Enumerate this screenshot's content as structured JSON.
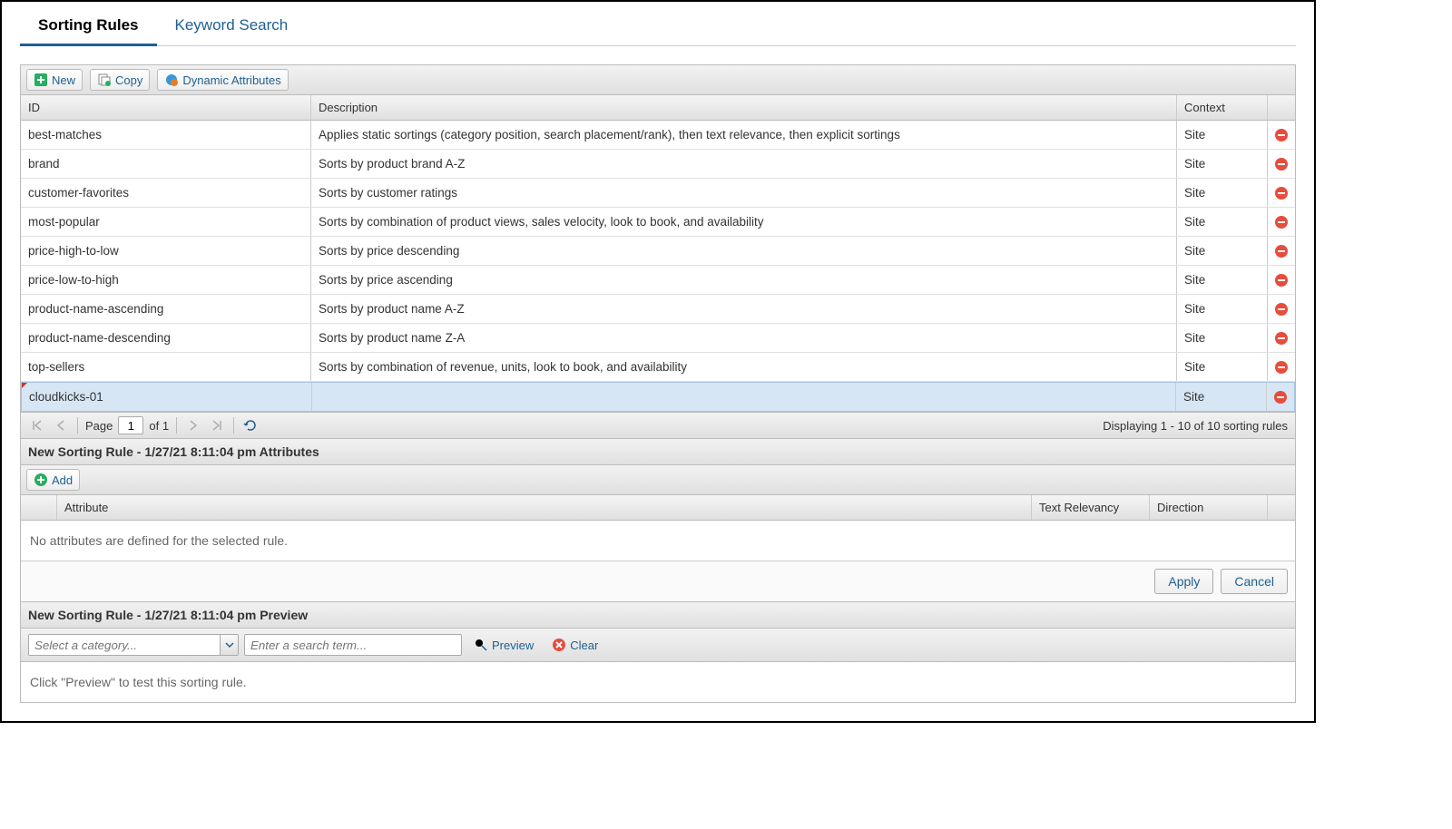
{
  "tabs": [
    {
      "label": "Sorting Rules",
      "active": true
    },
    {
      "label": "Keyword Search",
      "active": false
    }
  ],
  "toolbar": {
    "new_label": "New",
    "copy_label": "Copy",
    "dynamic_label": "Dynamic Attributes"
  },
  "columns": {
    "id": "ID",
    "desc": "Description",
    "ctx": "Context"
  },
  "rows": [
    {
      "id": "best-matches",
      "desc": "Applies static sortings (category position, search placement/rank), then text relevance, then explicit sortings",
      "ctx": "Site",
      "selected": false
    },
    {
      "id": "brand",
      "desc": "Sorts by product brand A-Z",
      "ctx": "Site",
      "selected": false
    },
    {
      "id": "customer-favorites",
      "desc": "Sorts by customer ratings",
      "ctx": "Site",
      "selected": false
    },
    {
      "id": "most-popular",
      "desc": "Sorts by combination of product views, sales velocity, look to book, and availability",
      "ctx": "Site",
      "selected": false
    },
    {
      "id": "price-high-to-low",
      "desc": "Sorts by price descending",
      "ctx": "Site",
      "selected": false
    },
    {
      "id": "price-low-to-high",
      "desc": "Sorts by price ascending",
      "ctx": "Site",
      "selected": false
    },
    {
      "id": "product-name-ascending",
      "desc": "Sorts by product name A-Z",
      "ctx": "Site",
      "selected": false
    },
    {
      "id": "product-name-descending",
      "desc": "Sorts by product name Z-A",
      "ctx": "Site",
      "selected": false
    },
    {
      "id": "top-sellers",
      "desc": "Sorts by combination of revenue, units, look to book, and availability",
      "ctx": "Site",
      "selected": false
    },
    {
      "id": "cloudkicks-01",
      "desc": "",
      "ctx": "Site",
      "selected": true
    }
  ],
  "pager": {
    "page_label": "Page",
    "page_value": "1",
    "of_label": "of 1",
    "display_text": "Displaying 1 - 10 of 10 sorting rules"
  },
  "attributes_section": {
    "title": "New Sorting Rule - 1/27/21 8:11:04 pm Attributes",
    "add_label": "Add",
    "columns": {
      "attr": "Attribute",
      "trel": "Text Relevancy",
      "dir": "Direction"
    },
    "empty_msg": "No attributes are defined for the selected rule.",
    "apply_label": "Apply",
    "cancel_label": "Cancel"
  },
  "preview_section": {
    "title": "New Sorting Rule - 1/27/21 8:11:04 pm Preview",
    "category_placeholder": "Select a category...",
    "search_placeholder": "Enter a search term...",
    "preview_label": "Preview",
    "clear_label": "Clear",
    "hint": "Click \"Preview\" to test this sorting rule."
  }
}
